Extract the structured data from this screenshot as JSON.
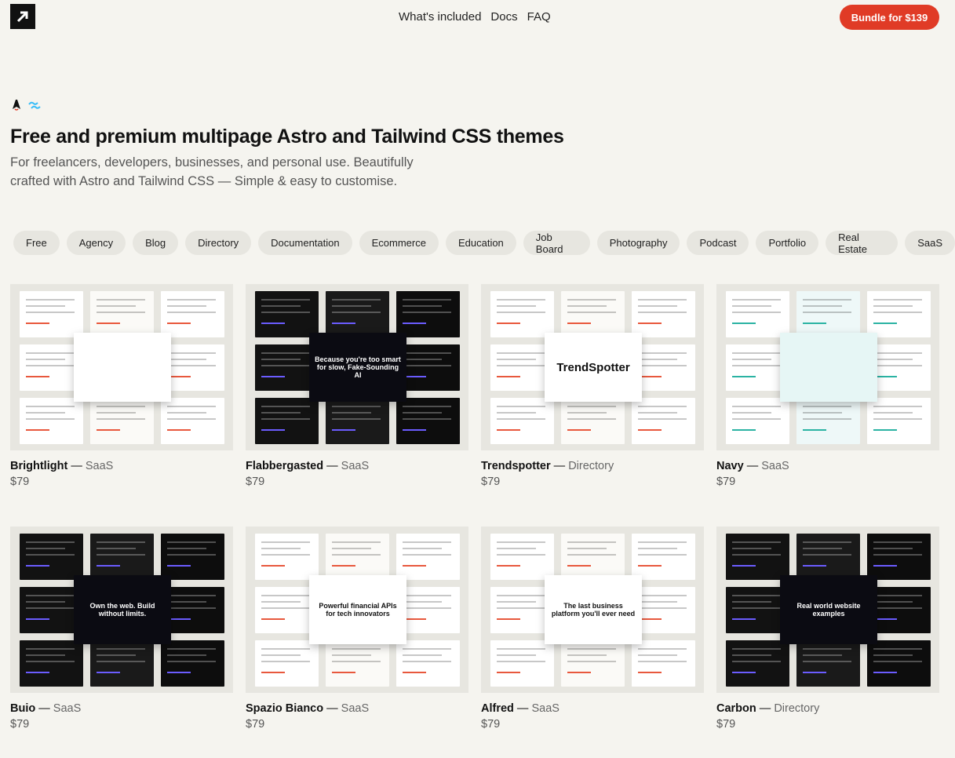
{
  "nav": {
    "links": [
      "What's included",
      "Docs",
      "FAQ"
    ],
    "cta_label": "Bundle for $139"
  },
  "hero": {
    "title": "Free and premium multipage Astro and Tailwind CSS themes",
    "subtitle": "For freelancers, developers, businesses, and personal use. Beautifully crafted with Astro and Tailwind CSS — Simple & easy to customise."
  },
  "filters": [
    "Free",
    "Agency",
    "Blog",
    "Directory",
    "Documentation",
    "Ecommerce",
    "Education",
    "Job Board",
    "Photography",
    "Podcast",
    "Portfolio",
    "Real Estate",
    "SaaS"
  ],
  "themes": [
    {
      "name": "Brightlight",
      "category": "SaaS",
      "price": "$79",
      "center_text": "",
      "theme": "light"
    },
    {
      "name": "Flabbergasted",
      "category": "SaaS",
      "price": "$79",
      "center_text": "Because you're too smart for slow, Fake-Sounding AI",
      "theme": "dark"
    },
    {
      "name": "Trendspotter",
      "category": "Directory",
      "price": "$79",
      "center_text": "TrendSpotter",
      "theme": "light"
    },
    {
      "name": "Navy",
      "category": "SaaS",
      "price": "$79",
      "center_text": "",
      "theme": "teal"
    },
    {
      "name": "Buio",
      "category": "SaaS",
      "price": "$79",
      "center_text": "Own the web. Build without limits.",
      "theme": "dark"
    },
    {
      "name": "Spazio Bianco",
      "category": "SaaS",
      "price": "$79",
      "center_text": "Powerful financial APIs for tech innovators",
      "theme": "light"
    },
    {
      "name": "Alfred",
      "category": "SaaS",
      "price": "$79",
      "center_text": "The last business platform you'll ever need",
      "theme": "light"
    },
    {
      "name": "Carbon",
      "category": "Directory",
      "price": "$79",
      "center_text": "Real world website examples",
      "theme": "dark"
    }
  ],
  "colors": {
    "background": "#f5f4ef",
    "accent": "#e03b26",
    "chip": "#e7e6e0"
  },
  "icons": [
    "logo-icon",
    "astro-icon",
    "tailwind-icon"
  ]
}
